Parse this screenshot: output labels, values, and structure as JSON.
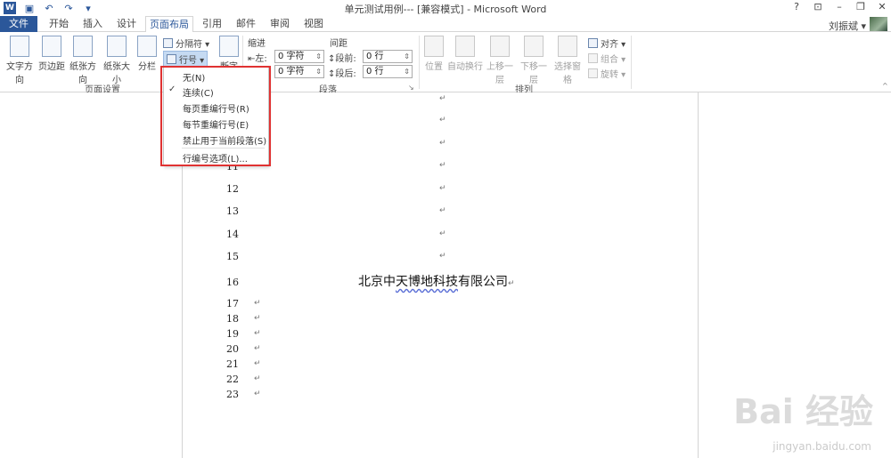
{
  "window": {
    "title": "单元测试用例--- [兼容模式] - Microsoft Word",
    "controls": [
      "?",
      "⊡",
      "–",
      "❐",
      "✕"
    ]
  },
  "qat": {
    "word_logo": "W"
  },
  "tabs": [
    {
      "label": "文件"
    },
    {
      "label": "开始"
    },
    {
      "label": "插入"
    },
    {
      "label": "设计"
    },
    {
      "label": "页面布局"
    },
    {
      "label": "引用"
    },
    {
      "label": "邮件"
    },
    {
      "label": "审阅"
    },
    {
      "label": "视图"
    }
  ],
  "user": {
    "name": "刘振斌 ▾"
  },
  "ribbon": {
    "page_setup": {
      "text_direction": "文字方向",
      "margins": "页边距",
      "orientation": "纸张方向",
      "size": "纸张大小",
      "columns": "分栏",
      "breaks": "分隔符 ▾",
      "line_numbers": "行号 ▾",
      "hyphenation_partial": "断字",
      "group_label": "页面设置"
    },
    "indent": {
      "heading": "缩进",
      "left_label": "左:",
      "left_value": "0 字符",
      "right_label": "右:",
      "right_value": "0 字符"
    },
    "spacing": {
      "heading": "间距",
      "before_label": "段前:",
      "before_value": "0 行",
      "after_label": "段后:",
      "after_value": "0 行"
    },
    "paragraph_group_label": "段落",
    "arrange": {
      "position": "位置",
      "wrap_text": "自动换行",
      "bring_forward": "上移一层",
      "send_backward": "下移一层",
      "selection_pane": "选择窗格",
      "align": "对齐 ▾",
      "group": "组合 ▾",
      "rotate": "旋转 ▾",
      "group_label": "排列"
    }
  },
  "line_numbers_menu": {
    "items": [
      {
        "label": "无(N)"
      },
      {
        "label": "连续(C)"
      },
      {
        "label": "每页重编行号(R)"
      },
      {
        "label": "每节重编行号(E)"
      },
      {
        "label": "禁止用于当前段落(S)"
      },
      {
        "label": "行编号选项(L)..."
      }
    ],
    "checked_item": "连续(C)"
  },
  "document": {
    "paragraph_mark": "↵",
    "line_numbers": [
      {
        "n": "11"
      },
      {
        "n": "12"
      },
      {
        "n": "13"
      },
      {
        "n": "14"
      },
      {
        "n": "15"
      },
      {
        "n": "16"
      },
      {
        "n": "17"
      },
      {
        "n": "18"
      },
      {
        "n": "19"
      },
      {
        "n": "20"
      },
      {
        "n": "21"
      },
      {
        "n": "22"
      },
      {
        "n": "23"
      }
    ],
    "heading_pre": "北京中",
    "heading_squiggle": "天博地科技",
    "heading_post": "有限公司"
  },
  "watermark": {
    "brand": "Bai 经验",
    "url": "jingyan.baidu.com"
  },
  "colors": {
    "accent": "#2b579a",
    "highlight": "#e03232"
  }
}
